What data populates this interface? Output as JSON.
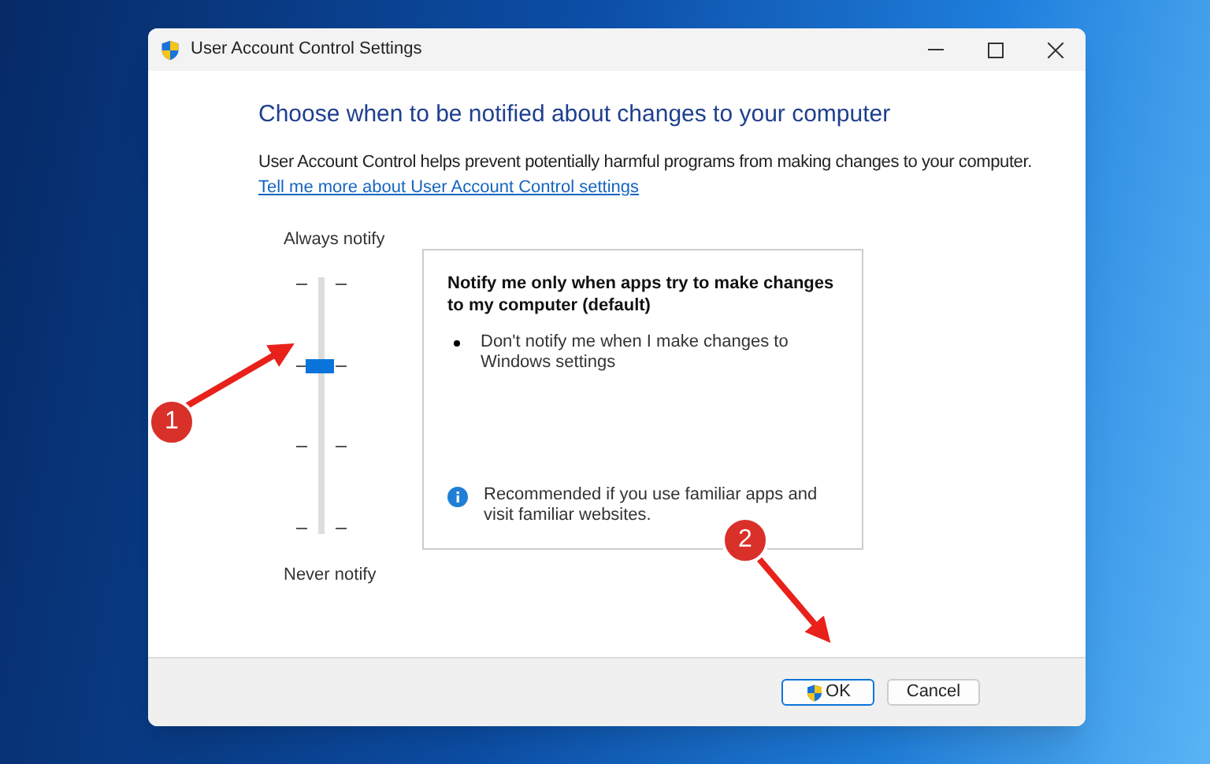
{
  "window": {
    "title": "User Account Control Settings"
  },
  "heading": "Choose when to be notified about changes to your computer",
  "description": "User Account Control helps prevent potentially harmful programs from making changes to your computer.",
  "help_link": "Tell me more about User Account Control settings",
  "slider": {
    "top_label": "Always notify",
    "bottom_label": "Never notify",
    "level": 0.667
  },
  "info_panel": {
    "title": "Notify me only when apps try to make changes to my computer (default)",
    "bullets": [
      "Don't notify me when I make changes to Windows settings"
    ],
    "note": "Recommended if you use familiar apps and visit familiar websites."
  },
  "buttons": [
    {
      "label": "OK",
      "kind": "shield",
      "default": true
    },
    {
      "label": "Cancel",
      "kind": "plain",
      "default": false
    }
  ],
  "annotations": [
    {
      "label": "1"
    },
    {
      "label": "2"
    }
  ]
}
